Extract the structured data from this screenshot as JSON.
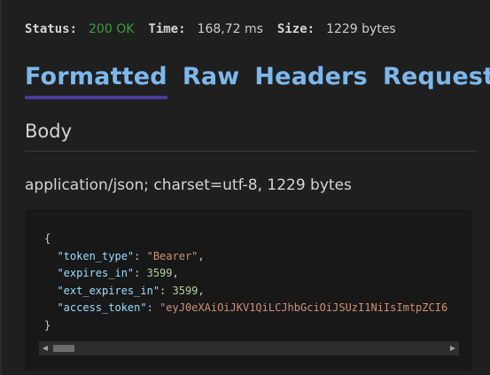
{
  "status_bar": {
    "status_label": "Status:",
    "status_value": "200 OK",
    "time_label": "Time:",
    "time_value": "168,72 ms",
    "size_label": "Size:",
    "size_value": "1229 bytes"
  },
  "tabs": [
    {
      "label": "Formatted",
      "active": true
    },
    {
      "label": "Raw",
      "active": false
    },
    {
      "label": "Headers",
      "active": false
    },
    {
      "label": "Request",
      "active": false
    }
  ],
  "body_section": {
    "title": "Body",
    "content_type": "application/json; charset=utf-8, 1229 bytes"
  },
  "json_body": {
    "open_brace": "{",
    "close_brace": "}",
    "entries": [
      {
        "key": "\"token_type\"",
        "value": "\"Bearer\"",
        "value_type": "string"
      },
      {
        "key": "\"expires_in\"",
        "value": "3599",
        "value_type": "number"
      },
      {
        "key": "\"ext_expires_in\"",
        "value": "3599",
        "value_type": "number"
      },
      {
        "key": "\"access_token\"",
        "value": "\"eyJ0eXAiOiJKV1QiLCJhbGciOiJSUzI1NiIsImtpZCI6",
        "value_type": "string"
      }
    ]
  },
  "scrollbar": {
    "left_arrow_icon": "triangle-left-icon",
    "right_arrow_icon": "triangle-right-icon"
  },
  "colors": {
    "background": "#1f1f1f",
    "status_ok": "#3f9a3c",
    "tab_text": "#7cb8ec",
    "tab_underline": "#4a3a96",
    "json_key": "#9cdcfe",
    "json_string": "#ce9178",
    "json_number": "#b5cea8"
  }
}
